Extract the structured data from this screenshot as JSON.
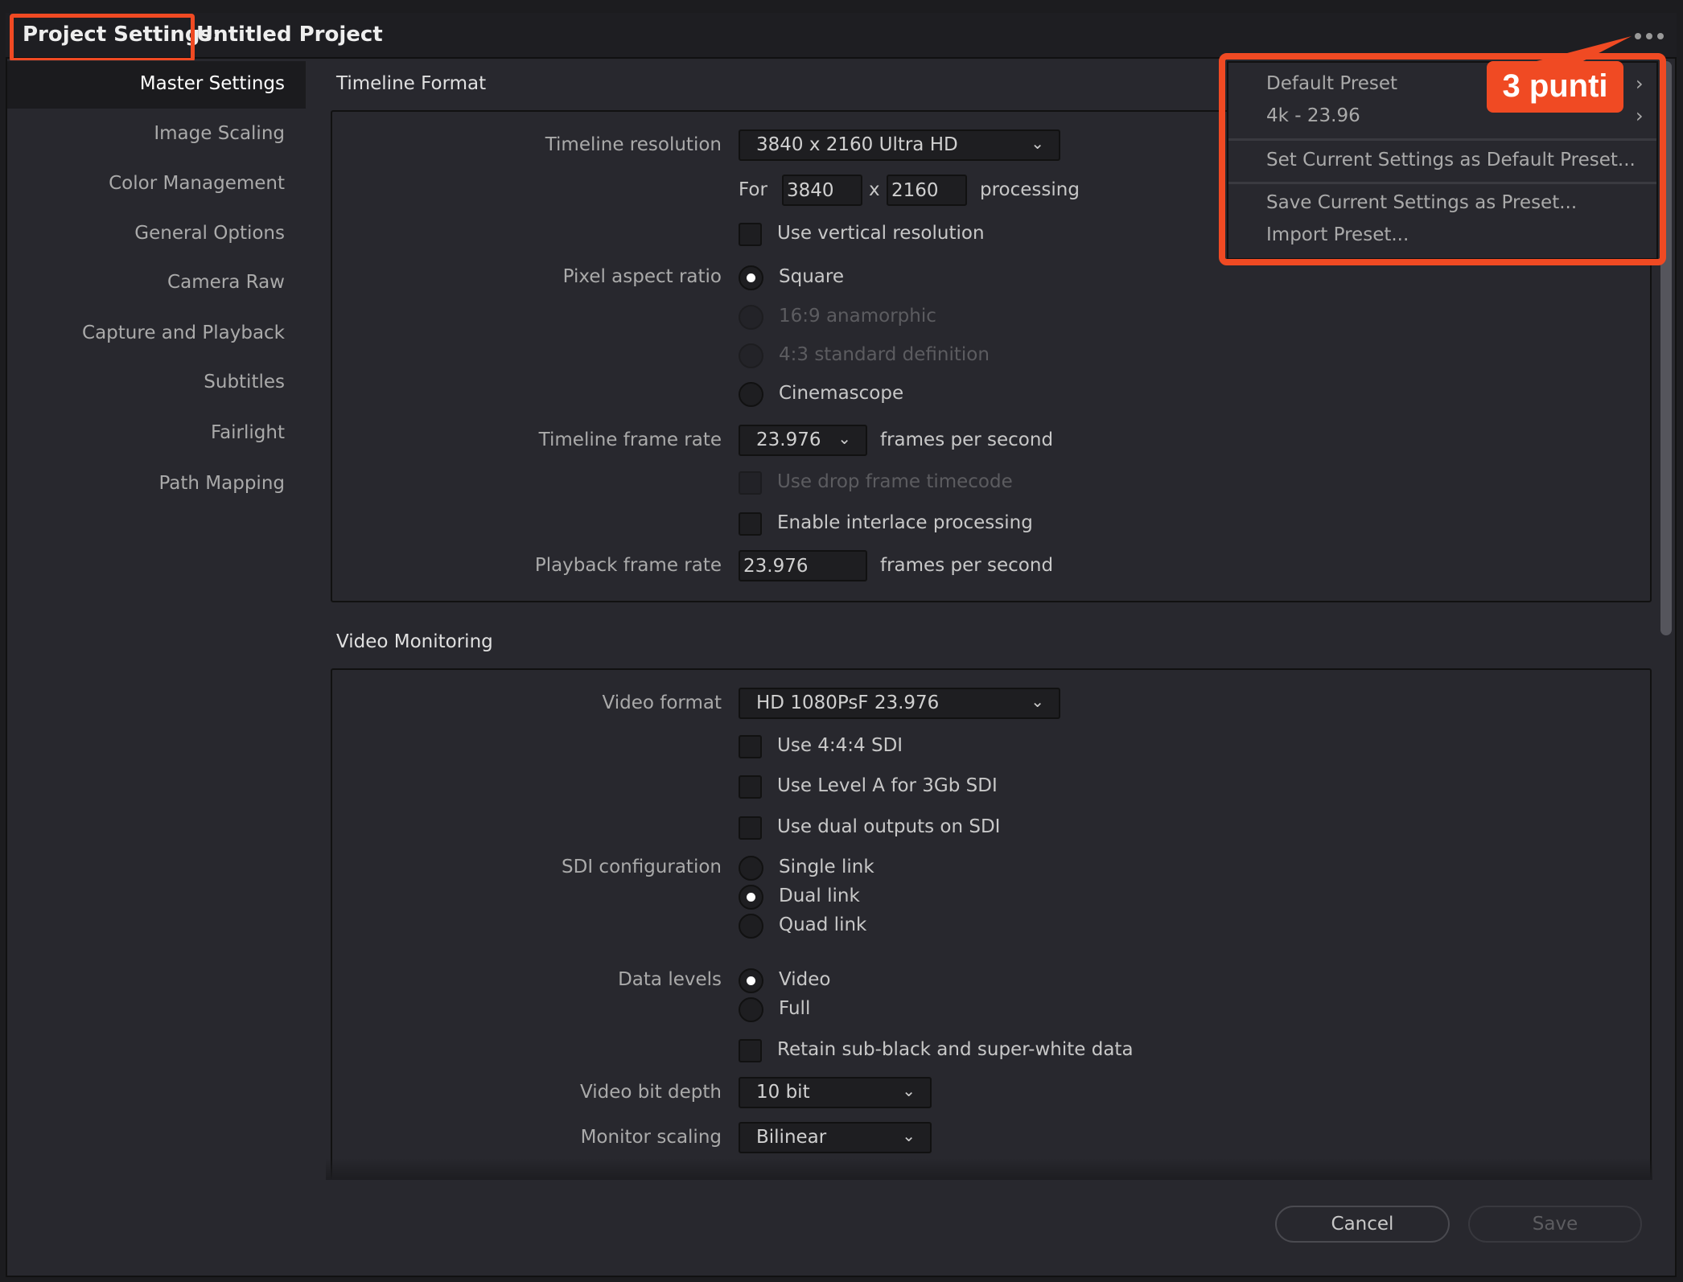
{
  "window": {
    "title_prefix": "Project Settings:",
    "title_project": "Untitled Project"
  },
  "sidebar": {
    "items": [
      {
        "label": "Master Settings",
        "active": true
      },
      {
        "label": "Image Scaling"
      },
      {
        "label": "Color Management"
      },
      {
        "label": "General Options"
      },
      {
        "label": "Camera Raw"
      },
      {
        "label": "Capture and Playback"
      },
      {
        "label": "Subtitles"
      },
      {
        "label": "Fairlight"
      },
      {
        "label": "Path Mapping"
      }
    ]
  },
  "timeline_format": {
    "title": "Timeline Format",
    "resolution_label": "Timeline resolution",
    "resolution_value": "3840 x 2160 Ultra HD",
    "for_label": "For",
    "width": "3840",
    "x_label": "x",
    "height": "2160",
    "processing_label": "processing",
    "vertical_res": "Use vertical resolution",
    "par_label": "Pixel aspect ratio",
    "par_options": [
      "Square",
      "16:9 anamorphic",
      "4:3 standard definition",
      "Cinemascope"
    ],
    "par_selected": "Square",
    "frame_rate_label": "Timeline frame rate",
    "frame_rate_value": "23.976",
    "fps_label": "frames per second",
    "drop_frame": "Use drop frame timecode",
    "interlace": "Enable interlace processing",
    "playback_label": "Playback frame rate",
    "playback_value": "23.976",
    "playback_fps_label": "frames per second"
  },
  "video_monitoring": {
    "title": "Video Monitoring",
    "format_label": "Video format",
    "format_value": "HD 1080PsF 23.976",
    "sdi444": "Use 4:4:4 SDI",
    "levelA": "Use Level A for 3Gb SDI",
    "dual_outputs": "Use dual outputs on SDI",
    "sdi_label": "SDI configuration",
    "sdi_options": [
      "Single link",
      "Dual link",
      "Quad link"
    ],
    "sdi_selected": "Dual link",
    "levels_label": "Data levels",
    "levels_options": [
      "Video",
      "Full"
    ],
    "levels_selected": "Video",
    "retain": "Retain sub-black and super-white data",
    "bit_depth_label": "Video bit depth",
    "bit_depth_value": "10 bit",
    "scaling_label": "Monitor scaling",
    "scaling_value": "Bilinear"
  },
  "menu": {
    "items": [
      "Default Preset",
      "4k - 23.96",
      "Set Current Settings as Default Preset...",
      "Save Current Settings as Preset...",
      "Import Preset..."
    ]
  },
  "annotation": {
    "label": "3 punti",
    "color": "#f04a23"
  },
  "footer": {
    "cancel": "Cancel",
    "save": "Save"
  }
}
